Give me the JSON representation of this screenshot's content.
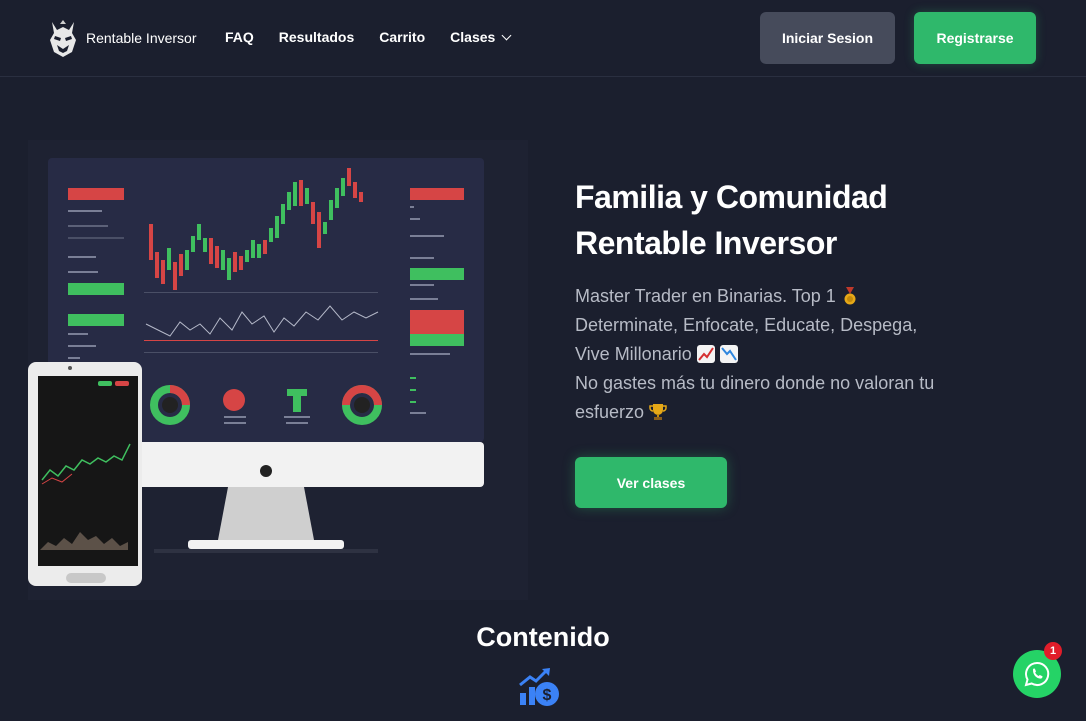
{
  "nav": {
    "brand": "Rentable Inversor",
    "links": [
      "FAQ",
      "Resultados",
      "Carrito",
      "Clases"
    ],
    "login": "Iniciar Sesion",
    "register": "Registrarse"
  },
  "hero": {
    "title_line1": "Familia y Comunidad",
    "title_line2": "Rentable Inversor",
    "desc_line1": "Master Trader en Binarias. Top 1",
    "desc_line2": "Determinate, Enfocate, Educate, Despega,",
    "desc_line3": "Vive Millonario",
    "desc_line4": "No gastes más tu dinero donde no valoran tu",
    "desc_line5": "esfuerzo",
    "cta": "Ver clases"
  },
  "content": {
    "title": "Contenido"
  },
  "whatsapp": {
    "badge": "1"
  },
  "icons": [
    "logo-icon",
    "chevron-down-icon",
    "medal-icon",
    "chart-up-icon",
    "chart-down-icon",
    "trophy-icon",
    "money-growth-icon",
    "whatsapp-icon"
  ],
  "colors": {
    "background": "#1b1f2e",
    "accent": "#2fb86b",
    "login_button": "#464b5b",
    "whatsapp": "#25d366",
    "badge": "#e11d2a"
  }
}
